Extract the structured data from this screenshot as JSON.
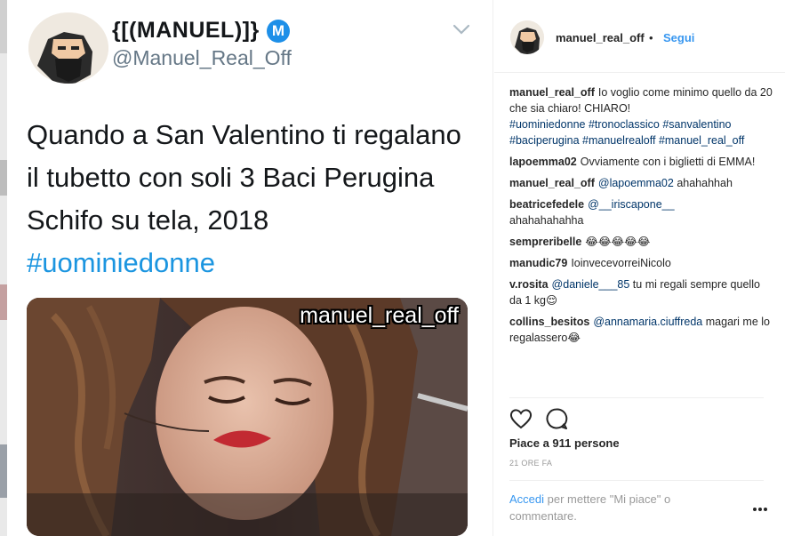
{
  "tweet": {
    "display_name": "{[(MANUEL)]}",
    "badge": "M",
    "handle": "@Manuel_Real_Off",
    "text_lines": [
      "Quando a San Valentino ti regalano",
      "il tubetto con soli 3 Baci Perugina",
      "Schifo su tela, 2018"
    ],
    "hashtag": "#uominiedonne",
    "image_caption": "manuel_real_off"
  },
  "header": {
    "username": "manuel_real_off",
    "dot": "•",
    "follow_label": "Segui"
  },
  "comments": [
    {
      "user": "manuel_real_off",
      "text": "Io voglio come minimo quello da 20 che sia chiaro! CHIARO!",
      "mention": "",
      "after": ""
    },
    {
      "user": "",
      "text": "",
      "mention": "#uominiedonne #tronoclassico #sanvalentino #baciperugina #manuelrealoff #manuel_real_off",
      "after": ""
    },
    {
      "user": "lapoemma02",
      "text": "Ovviamente con i biglietti di EMMA!",
      "mention": "",
      "after": ""
    },
    {
      "user": "manuel_real_off",
      "text": "",
      "mention": "@lapoemma02",
      "after": "ahahahhah"
    },
    {
      "user": "beatricefedele",
      "text": "",
      "mention": "@__iriscapone__",
      "after": "ahahahahahha"
    },
    {
      "user": "sempreribelle",
      "text": "😂😂😂😂😂",
      "mention": "",
      "after": ""
    },
    {
      "user": "manudic79",
      "text": "IoinvecevorreiNicolo",
      "mention": "",
      "after": ""
    },
    {
      "user": "v.rosita",
      "text": "",
      "mention": "@daniele___85",
      "after": "tu mi regali sempre quello da 1 kg😌"
    },
    {
      "user": "collins_besitos",
      "text": "",
      "mention": "@annamaria.ciuffreda",
      "after": "magari me lo regalassero😂"
    }
  ],
  "actions": {
    "like_icon": "heart-icon",
    "comment_icon": "comment-icon"
  },
  "likes": "Piace a 911 persone",
  "time": "21 ORE FA",
  "login": {
    "link": "Accedi",
    "text": "per mettere \"Mi piace\" o commentare."
  },
  "colors": {
    "link_blue": "#3897f0",
    "twitter_blue": "#1b95e0",
    "mention_blue": "#003569"
  }
}
